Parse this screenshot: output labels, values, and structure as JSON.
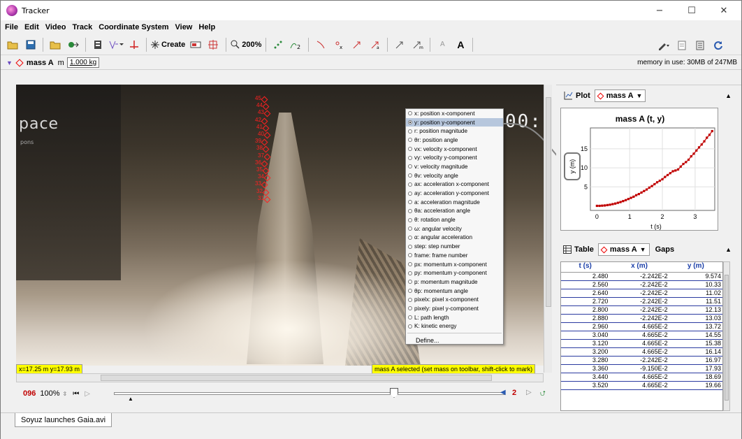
{
  "window": {
    "title": "Tracker",
    "minimize": "−",
    "maximize": "☐",
    "close": "✕"
  },
  "menu": [
    "File",
    "Edit",
    "Video",
    "Track",
    "Coordinate System",
    "View",
    "Help"
  ],
  "toolbar": {
    "create_label": "Create",
    "zoom_label": "200%",
    "font_small": "A",
    "font_large": "A"
  },
  "trackbar": {
    "track_name": "mass A",
    "mass_prefix": "m",
    "mass_value": "1.000 kg",
    "memory": "memory in use: 30MB of 247MB"
  },
  "video": {
    "logo_text": "pace",
    "sub_text": "pons",
    "clock_text": "00:",
    "marker_labels": [
      "45",
      "44",
      "43",
      "42",
      "41",
      "40",
      "39",
      "38",
      "37",
      "36",
      "35",
      "34",
      "33",
      "32",
      "31"
    ],
    "coords": "x=17.25 m  y=17.93 m",
    "status": "mass A selected (set mass on toolbar, shift-click to mark)",
    "dropdown_items": [
      "x: position x-component",
      "y: position y-component",
      "r: position magnitude",
      "θr: position angle",
      "vx: velocity x-component",
      "vy: velocity y-component",
      "v: velocity magnitude",
      "θv: velocity angle",
      "ax: acceleration x-component",
      "ay: acceleration y-component",
      "a: acceleration magnitude",
      "θa: acceleration angle",
      "θ: rotation angle",
      "ω: angular velocity",
      "α: angular acceleration",
      "step: step number",
      "frame: frame number",
      "px: momentum x-component",
      "py: momentum y-component",
      "p: momentum magnitude",
      "θp: momentum angle",
      "pixelx: pixel x-component",
      "pixely: pixel y-component",
      "L: path length",
      "K: kinetic energy"
    ],
    "dropdown_selected_index": 1,
    "define_label": "Define..."
  },
  "player": {
    "frame": "096",
    "rate": "100%",
    "step_count": "2",
    "slider_position": 0.96
  },
  "plot": {
    "panel_label": "Plot",
    "track": "mass A",
    "title": "mass A (t, y)",
    "ylabel": "y (m)",
    "xlabel": "t (s)",
    "x_ticks": [
      "0",
      "1",
      "2",
      "3"
    ],
    "y_ticks": [
      "5",
      "10",
      "15"
    ]
  },
  "chart_data": {
    "type": "scatter",
    "title": "mass A (t, y)",
    "xlabel": "t (s)",
    "ylabel": "y (m)",
    "xlim": [
      -0.2,
      3.6
    ],
    "ylim": [
      -1.2,
      20.5
    ],
    "x": [
      0.0,
      0.08,
      0.16,
      0.24,
      0.32,
      0.4,
      0.48,
      0.56,
      0.64,
      0.72,
      0.8,
      0.88,
      0.96,
      1.04,
      1.12,
      1.2,
      1.28,
      1.36,
      1.44,
      1.52,
      1.6,
      1.68,
      1.76,
      1.84,
      1.92,
      2.0,
      2.08,
      2.16,
      2.24,
      2.32,
      2.4,
      2.48,
      2.56,
      2.64,
      2.72,
      2.8,
      2.88,
      2.96,
      3.04,
      3.12,
      3.2,
      3.28,
      3.36,
      3.44,
      3.52
    ],
    "y": [
      0.0,
      0.0,
      0.05,
      0.1,
      0.2,
      0.3,
      0.45,
      0.6,
      0.8,
      1.0,
      1.25,
      1.5,
      1.8,
      2.1,
      2.4,
      2.8,
      3.1,
      3.5,
      3.9,
      4.3,
      4.8,
      5.2,
      5.7,
      6.2,
      6.6,
      7.0,
      7.6,
      8.1,
      8.6,
      9.1,
      9.3,
      9.57,
      10.33,
      11.02,
      11.51,
      12.13,
      13.03,
      13.72,
      14.55,
      15.38,
      16.14,
      16.97,
      17.93,
      18.69,
      19.66
    ],
    "series": [
      {
        "color": "#c00000"
      }
    ]
  },
  "table": {
    "panel_label": "Table",
    "track": "mass A",
    "gaps_label": "Gaps",
    "columns": [
      "t (s)",
      "x (m)",
      "y (m)"
    ],
    "rows": [
      [
        "2.480",
        "-2.242E-2",
        "9.574"
      ],
      [
        "2.560",
        "-2.242E-2",
        "10.33"
      ],
      [
        "2.640",
        "-2.242E-2",
        "11.02"
      ],
      [
        "2.720",
        "-2.242E-2",
        "11.51"
      ],
      [
        "2.800",
        "-2.242E-2",
        "12.13"
      ],
      [
        "2.880",
        "-2.242E-2",
        "13.03"
      ],
      [
        "2.960",
        "4.665E-2",
        "13.72"
      ],
      [
        "3.040",
        "4.665E-2",
        "14.55"
      ],
      [
        "3.120",
        "4.665E-2",
        "15.38"
      ],
      [
        "3.200",
        "4.665E-2",
        "16.14"
      ],
      [
        "3.280",
        "-2.242E-2",
        "16.97"
      ],
      [
        "3.360",
        "-9.150E-2",
        "17.93"
      ],
      [
        "3.440",
        "4.665E-2",
        "18.69"
      ],
      [
        "3.520",
        "4.665E-2",
        "19.66"
      ]
    ]
  },
  "tabs": {
    "video_tab": "Soyuz launches Gaia.avi"
  },
  "colors": {
    "marker": "#ff2020",
    "highlight": "#ffff00",
    "frame_red": "#c00000",
    "selected_row": "#b7c7dd"
  }
}
